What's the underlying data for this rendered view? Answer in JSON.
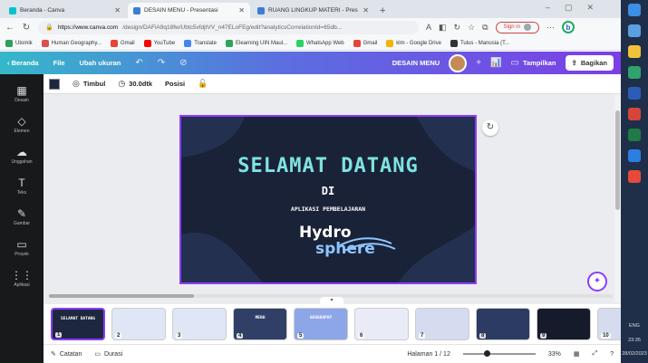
{
  "browser": {
    "tabs": [
      {
        "title": "Beranda - Canva",
        "color": "#00c4cc",
        "active": false
      },
      {
        "title": "DESAIN MENU - Presentasi",
        "color": "#3b7dd8",
        "active": true
      },
      {
        "title": "RUANG LINGKUP MATERI - Pres",
        "color": "#3b7dd8",
        "active": false
      }
    ],
    "new_tab": "+",
    "window_controls": [
      "–",
      "▢",
      "✕"
    ],
    "url_host": "https://www.canva.com",
    "url_path": "/design/DAFiA9q18fw/Ubtc5vfdjtVV_n47ELoFEg/edit?analyticsCorrelationId=65db...",
    "sign_in": "Sign in",
    "bookmarks": [
      {
        "label": "Utomik",
        "color": "#2e9f5a"
      },
      {
        "label": "Human Geography...",
        "color": "#d9534f"
      },
      {
        "label": "Gmail",
        "color": "#ea4335"
      },
      {
        "label": "YouTube",
        "color": "#ff0000"
      },
      {
        "label": "Translate",
        "color": "#4285f4"
      },
      {
        "label": "Elearning UIN Maul...",
        "color": "#2aa55a"
      },
      {
        "label": "WhatsApp Web",
        "color": "#25d366"
      },
      {
        "label": "Gmail",
        "color": "#ea4335"
      },
      {
        "label": "klm - Google Drive",
        "color": "#f4b400"
      },
      {
        "label": "Tulus - Manusia (T...",
        "color": "#333333"
      }
    ]
  },
  "canva_header": {
    "back": "Beranda",
    "file": "File",
    "resize": "Ubah ukuran",
    "design_name": "DESAIN MENU",
    "present": "Tampilkan",
    "share": "Bagikan"
  },
  "sidebar": [
    {
      "label": "Desain",
      "icon": "▦"
    },
    {
      "label": "Elemen",
      "icon": "◇"
    },
    {
      "label": "Unggahan",
      "icon": "☁"
    },
    {
      "label": "Teks",
      "icon": "T"
    },
    {
      "label": "Gambar",
      "icon": "✎"
    },
    {
      "label": "Proyek",
      "icon": "▭"
    },
    {
      "label": "Aplikasi",
      "icon": "⋮⋮"
    }
  ],
  "toolbar": {
    "animate": "Timbul",
    "duration": "30.0dtk",
    "position": "Posisi"
  },
  "slide": {
    "title": "SELAMAT DATANG",
    "line2": "DI",
    "line3": "APLIKASI PEMBELAJARAN",
    "logo_line1": "Hydro",
    "logo_line2": "sphere"
  },
  "thumbnails": [
    {
      "num": "1",
      "bg": "#1e2740",
      "title": "SELAMAT DATANG"
    },
    {
      "num": "2",
      "bg": "#dfe6f5",
      "title": ""
    },
    {
      "num": "3",
      "bg": "#dfe6f5",
      "title": ""
    },
    {
      "num": "4",
      "bg": "#2f3f66",
      "title": "MENU"
    },
    {
      "num": "5",
      "bg": "#8da6e8",
      "title": "GEOGRAPHY"
    },
    {
      "num": "6",
      "bg": "#e9ecf7",
      "title": ""
    },
    {
      "num": "7",
      "bg": "#d5dcf0",
      "title": ""
    },
    {
      "num": "8",
      "bg": "#2c3b63",
      "title": ""
    },
    {
      "num": "9",
      "bg": "#161b2c",
      "title": ""
    },
    {
      "num": "10",
      "bg": "#d5dcf0",
      "title": ""
    }
  ],
  "status": {
    "notes": "Catatan",
    "duration": "Durasi",
    "page": "Halaman 1 / 12",
    "zoom": "33%",
    "zoom_fraction": 0.33
  },
  "taskbar": {
    "lang": "ENG",
    "time": "23:35",
    "date": "28/02/2023"
  }
}
